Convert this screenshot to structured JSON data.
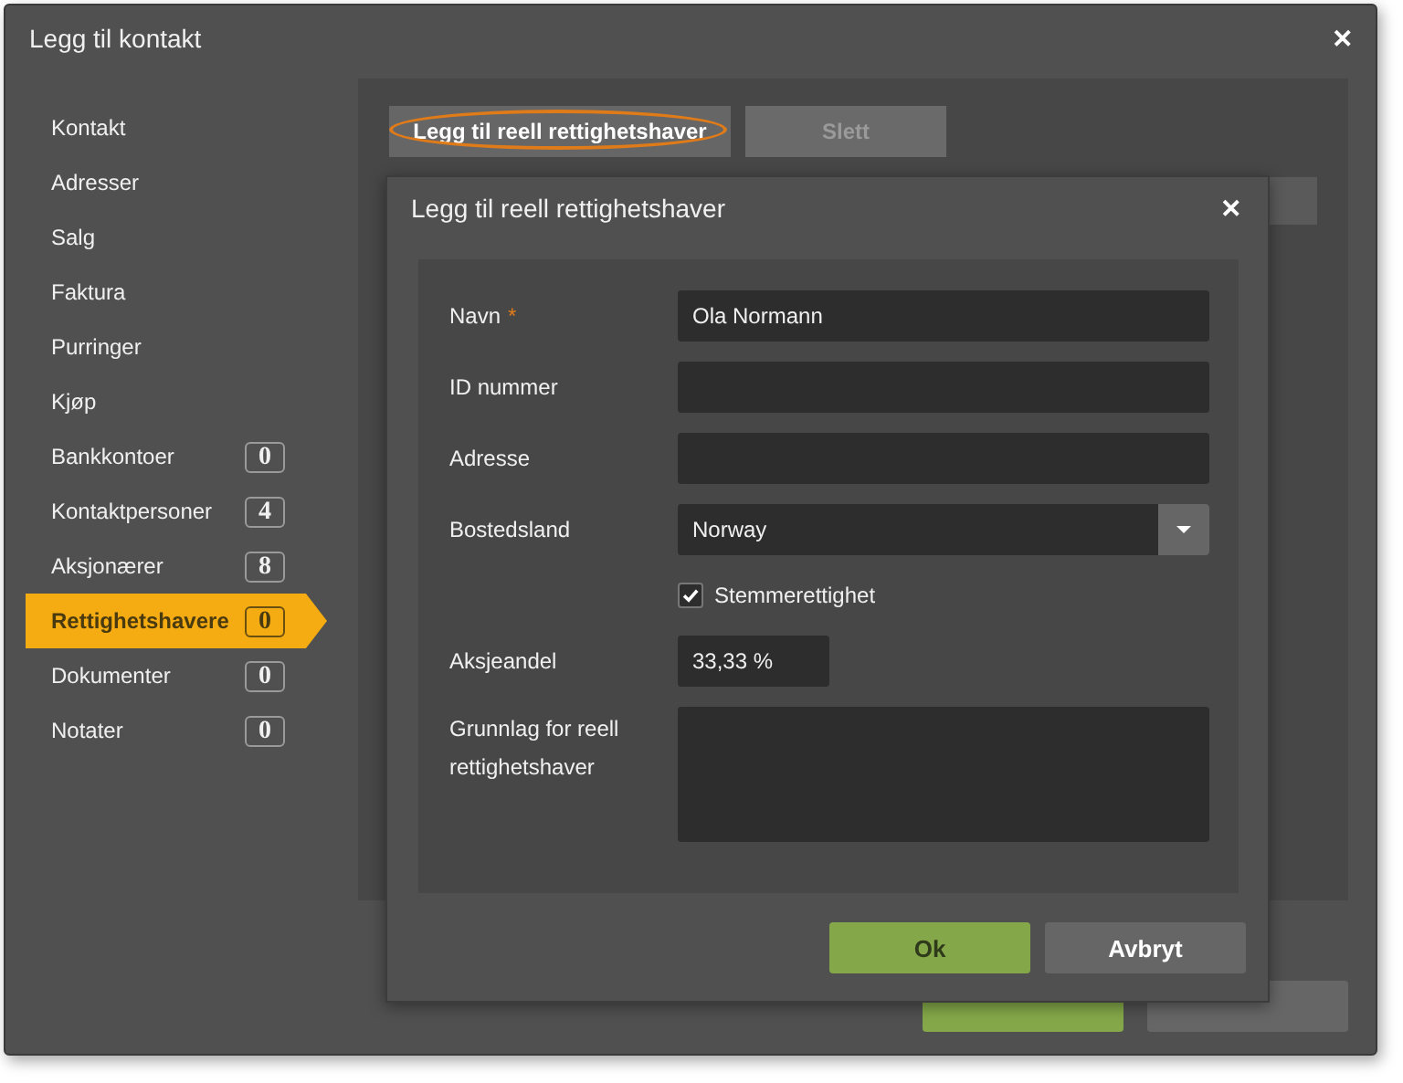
{
  "window": {
    "title": "Legg til kontakt",
    "close": "✕"
  },
  "sidebar": {
    "items": [
      {
        "label": "Kontakt",
        "selected": false
      },
      {
        "label": "Adresser",
        "selected": false
      },
      {
        "label": "Salg",
        "selected": false
      },
      {
        "label": "Faktura",
        "selected": false
      },
      {
        "label": "Purringer",
        "selected": false
      },
      {
        "label": "Kjøp",
        "selected": false
      },
      {
        "label": "Bankkontoer",
        "count": "0",
        "selected": false
      },
      {
        "label": "Kontaktpersoner",
        "count": "4",
        "selected": false
      },
      {
        "label": "Aksjonærer",
        "count": "8",
        "selected": false
      },
      {
        "label": "Rettighetshavere",
        "count": "0",
        "selected": true
      },
      {
        "label": "Dokumenter",
        "count": "0",
        "selected": false
      },
      {
        "label": "Notater",
        "count": "0",
        "selected": false
      }
    ]
  },
  "toolbar": [
    {
      "label": "Legg til reell rettighetshaver",
      "disabled": false,
      "highlighted": true
    },
    {
      "label": "Slett",
      "disabled": true,
      "highlighted": false
    }
  ],
  "footer_buttons": [
    {
      "kind": "primary"
    },
    {
      "kind": "secondary"
    }
  ],
  "dialog": {
    "title": "Legg til reell rettighetshaver",
    "close": "✕",
    "fields": [
      {
        "kind": "text",
        "label": "Navn",
        "required_mark": "*",
        "value": "Ola Normann"
      },
      {
        "kind": "text",
        "label": "ID nummer"
      },
      {
        "kind": "text",
        "label": "Adresse"
      },
      {
        "kind": "select",
        "label": "Bostedsland",
        "value": "Norway"
      },
      {
        "kind": "checkbox",
        "label": "Stemmerettighet",
        "checked": true
      },
      {
        "kind": "short",
        "label": "Aksjeandel",
        "value": "33,33 %"
      },
      {
        "kind": "textarea",
        "label": "Grunnlag for reell rettighetshaver"
      }
    ],
    "buttons": [
      {
        "label": "Ok",
        "kind": "primary"
      },
      {
        "label": "Avbryt",
        "kind": "secondary"
      }
    ]
  }
}
